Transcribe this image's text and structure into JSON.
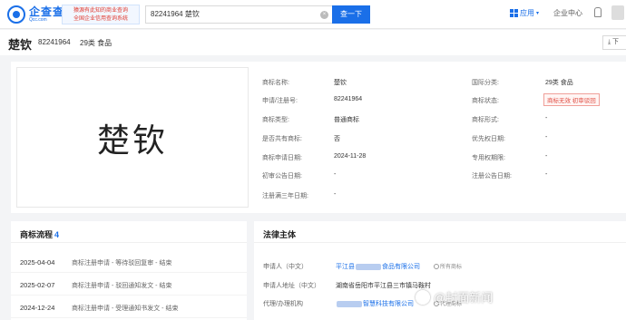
{
  "header": {
    "logo_name": "企查查",
    "logo_sub": "Qcc.com",
    "promo_line1": "猿源有此知的商业查询",
    "promo_line2": "全国企业信用查询系统",
    "search_value": "82241964 楚钦",
    "clear_icon": "×",
    "search_button": "查一下",
    "app_label": "应用",
    "enterprise_center": "企业中心"
  },
  "title": {
    "name": "楚钦",
    "reg_no": "82241964",
    "class": "29类 食品",
    "download_label": "下"
  },
  "trademark_image_text": "楚钦",
  "info": {
    "fields_left": [
      {
        "label": "商标名称:",
        "value": "楚钦"
      },
      {
        "label": "申请/注册号:",
        "value": "82241964"
      },
      {
        "label": "商标类型:",
        "value": "普通商标"
      },
      {
        "label": "是否共有商标:",
        "value": "否"
      },
      {
        "label": "商标申请日期:",
        "value": "2024-11-28"
      },
      {
        "label": "初审公告日期:",
        "value": "-"
      },
      {
        "label": "注册满三年日期:",
        "value": "-"
      }
    ],
    "fields_right": [
      {
        "label": "国际分类:",
        "value": "29类 食品"
      },
      {
        "label": "商标状态:",
        "value": "商标无效 初审驳回"
      },
      {
        "label": "商标形式:",
        "value": "-"
      },
      {
        "label": "优先权日期:",
        "value": "-"
      },
      {
        "label": "专用权期限:",
        "value": "-"
      },
      {
        "label": "注册公告日期:",
        "value": "-"
      }
    ],
    "status_color": "#e05045"
  },
  "flow": {
    "title": "商标流程",
    "count": "4",
    "rows": [
      {
        "date": "2025-04-04",
        "desc": "商标注册申请 - 等待驳回复审 - 结束"
      },
      {
        "date": "2025-02-07",
        "desc": "商标注册申请 - 驳回通知发文 - 结束"
      },
      {
        "date": "2024-12-24",
        "desc": "商标注册申请 - 受理通知书发文 - 结束"
      }
    ]
  },
  "legal": {
    "title": "法律主体",
    "applicant_label": "申请人（中文）",
    "applicant_prefix": "平江县",
    "applicant_suffix": "食品有限公司",
    "applicant_role": "所有商标",
    "address_label": "申请人地址（中文）",
    "address_value": "湖南省岳阳市平江县三市镇马鞍村",
    "agent_label": "代理/办理机构",
    "agent_value": "智慧科技有限公司",
    "agent_role": "代理商标"
  },
  "watermark": {
    "text": "@封面新闻",
    "left_text": "@代理商标"
  },
  "colors": {
    "brand": "#1a6fe8",
    "status_red": "#e05045"
  }
}
